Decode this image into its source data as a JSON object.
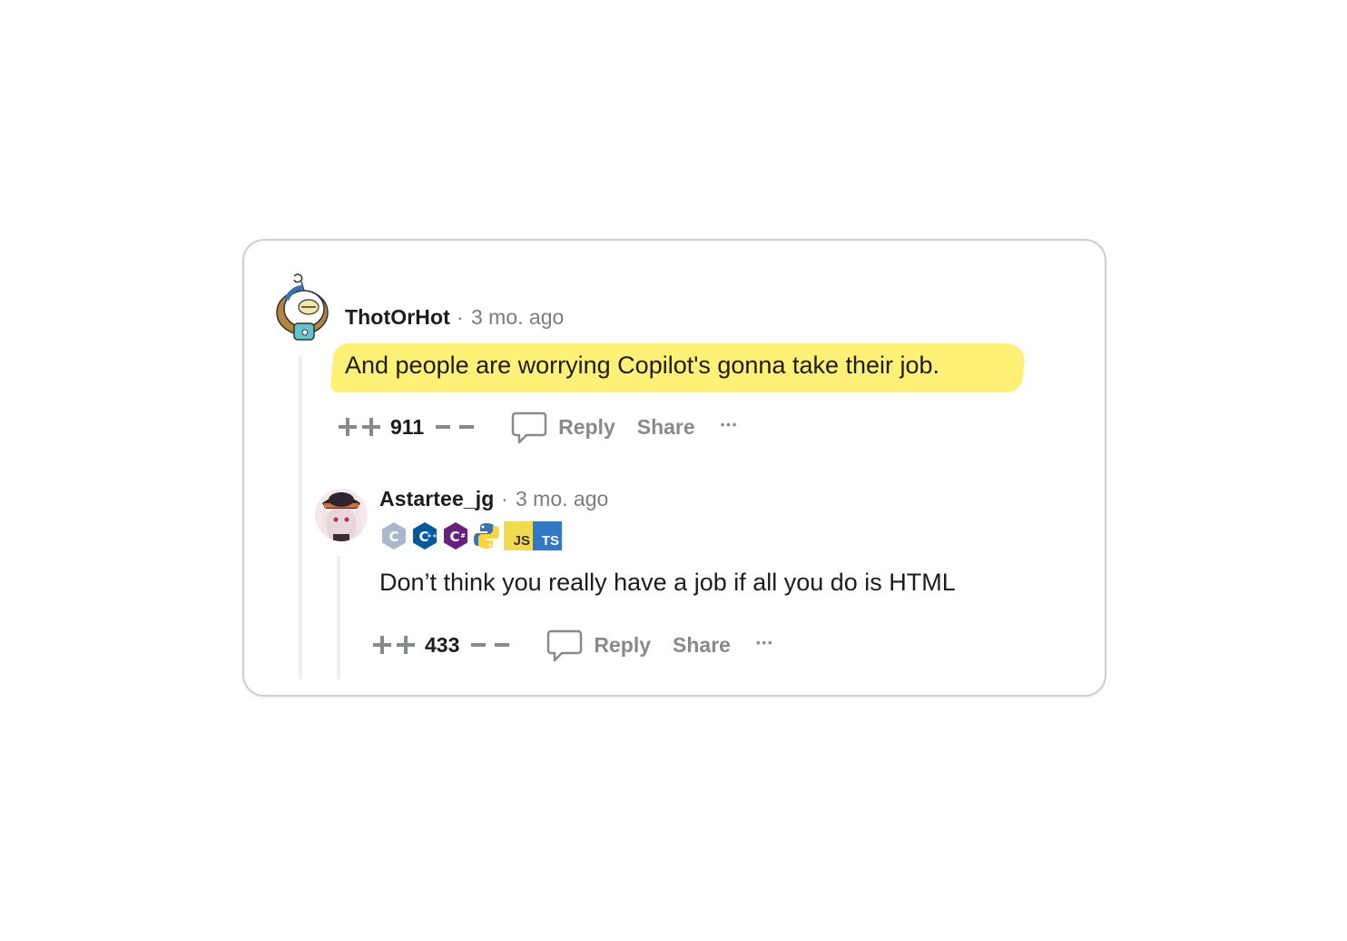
{
  "comments": [
    {
      "username": "ThotOrHot",
      "separator": "·",
      "time": "3 mo. ago",
      "body": "And people are worrying Copilot's gonna take their job.",
      "highlighted": true,
      "votes": "911",
      "reply_label": "Reply",
      "share_label": "Share",
      "more_label": "•••"
    },
    {
      "username": "Astartee_jg",
      "separator": "·",
      "time": "3 mo. ago",
      "flair": [
        "C",
        "C++",
        "C#",
        "Python",
        "JS",
        "TS"
      ],
      "flair_labels": {
        "js": "JS",
        "ts": "TS"
      },
      "body": "Don’t think you really have a job if all you do is HTML",
      "votes": "433",
      "reply_label": "Reply",
      "share_label": "Share",
      "more_label": "•••"
    }
  ],
  "colors": {
    "highlight": "#fff176",
    "meta_gray": "#7c7c7c",
    "action_gray": "#878a8c",
    "thread_line": "#edeff1",
    "c_flair": "#a8b9cc",
    "cpp_flair": "#00599c",
    "csharp_flair": "#68217a",
    "js_flair": "#f0db4f",
    "ts_flair": "#3178c6"
  }
}
